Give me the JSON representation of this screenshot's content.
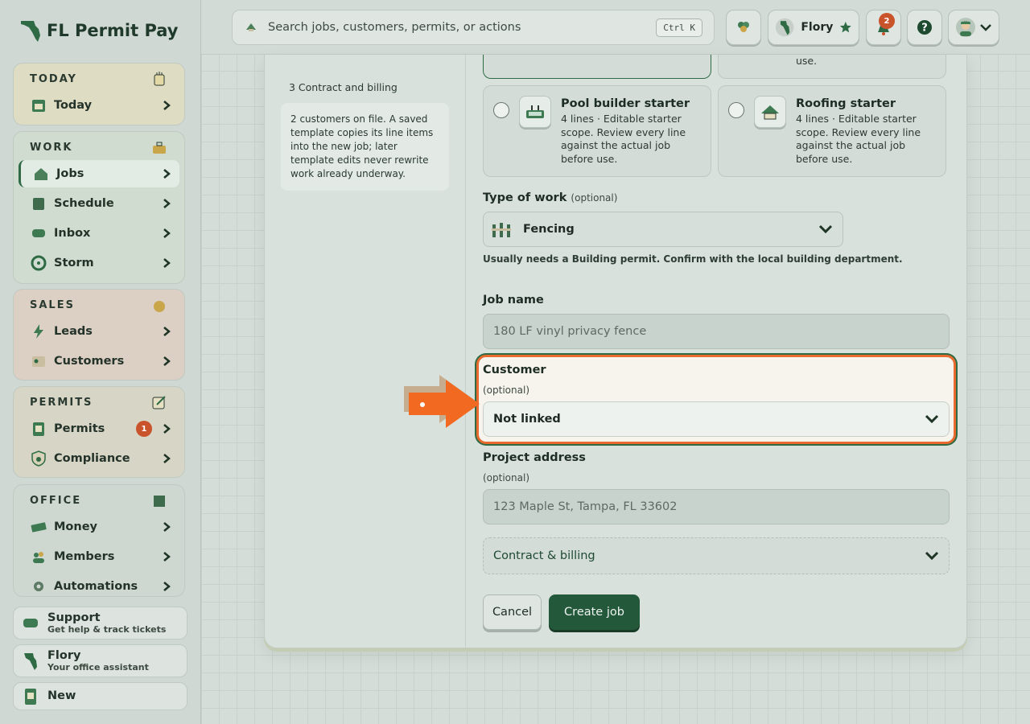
{
  "brand": {
    "name": "FL Permit Pay"
  },
  "sidebar": {
    "today": {
      "heading": "TODAY",
      "items": [
        {
          "label": "Today"
        }
      ]
    },
    "work": {
      "heading": "WORK",
      "items": [
        {
          "label": "Jobs"
        },
        {
          "label": "Schedule"
        },
        {
          "label": "Inbox"
        },
        {
          "label": "Storm"
        }
      ]
    },
    "sales": {
      "heading": "SALES",
      "items": [
        {
          "label": "Leads"
        },
        {
          "label": "Customers"
        }
      ]
    },
    "permits": {
      "heading": "PERMITS",
      "items": [
        {
          "label": "Permits",
          "badge": "1"
        },
        {
          "label": "Compliance"
        }
      ]
    },
    "office": {
      "heading": "OFFICE",
      "items": [
        {
          "label": "Money"
        },
        {
          "label": "Members"
        },
        {
          "label": "Automations"
        }
      ]
    },
    "support": {
      "title": "Support",
      "subtitle": "Get help & track tickets"
    },
    "assistant": {
      "title": "Flory",
      "subtitle": "Your office assistant"
    },
    "new": {
      "title": "New"
    }
  },
  "topbar": {
    "search_placeholder": "Search jobs, customers, permits, or actions",
    "search_shortcut": "Ctrl K",
    "assistant_name": "Flory",
    "notifications_count": "2"
  },
  "form": {
    "steps": {
      "step3": "3 Contract and billing"
    },
    "note": "2 customers on file. A saved template copies its line items into the new job; later template edits never rewrite work already underway.",
    "top_card_right_tail": "use.",
    "templates": [
      {
        "title": "Pool builder starter",
        "desc": "4 lines · Editable starter scope. Review every line against the actual job before use."
      },
      {
        "title": "Roofing starter",
        "desc": "4 lines · Editable starter scope. Review every line against the actual job before use."
      }
    ],
    "type_of_work": {
      "label": "Type of work",
      "optional": "(optional)",
      "value": "Fencing",
      "help": "Usually needs a Building permit. Confirm with the local building department."
    },
    "job_name": {
      "label": "Job name",
      "placeholder": "180 LF vinyl privacy fence"
    },
    "customer": {
      "label": "Customer",
      "optional": "(optional)",
      "value": "Not linked"
    },
    "project_address": {
      "label": "Project address",
      "optional": "(optional)",
      "placeholder": "123 Maple St, Tampa, FL 33602"
    },
    "contract_billing": {
      "label": "Contract & billing"
    },
    "cancel_label": "Cancel",
    "create_label": "Create job"
  },
  "colors": {
    "accent": "#2e6b45",
    "highlight": "#e86a2e",
    "badge": "#c9542b"
  }
}
